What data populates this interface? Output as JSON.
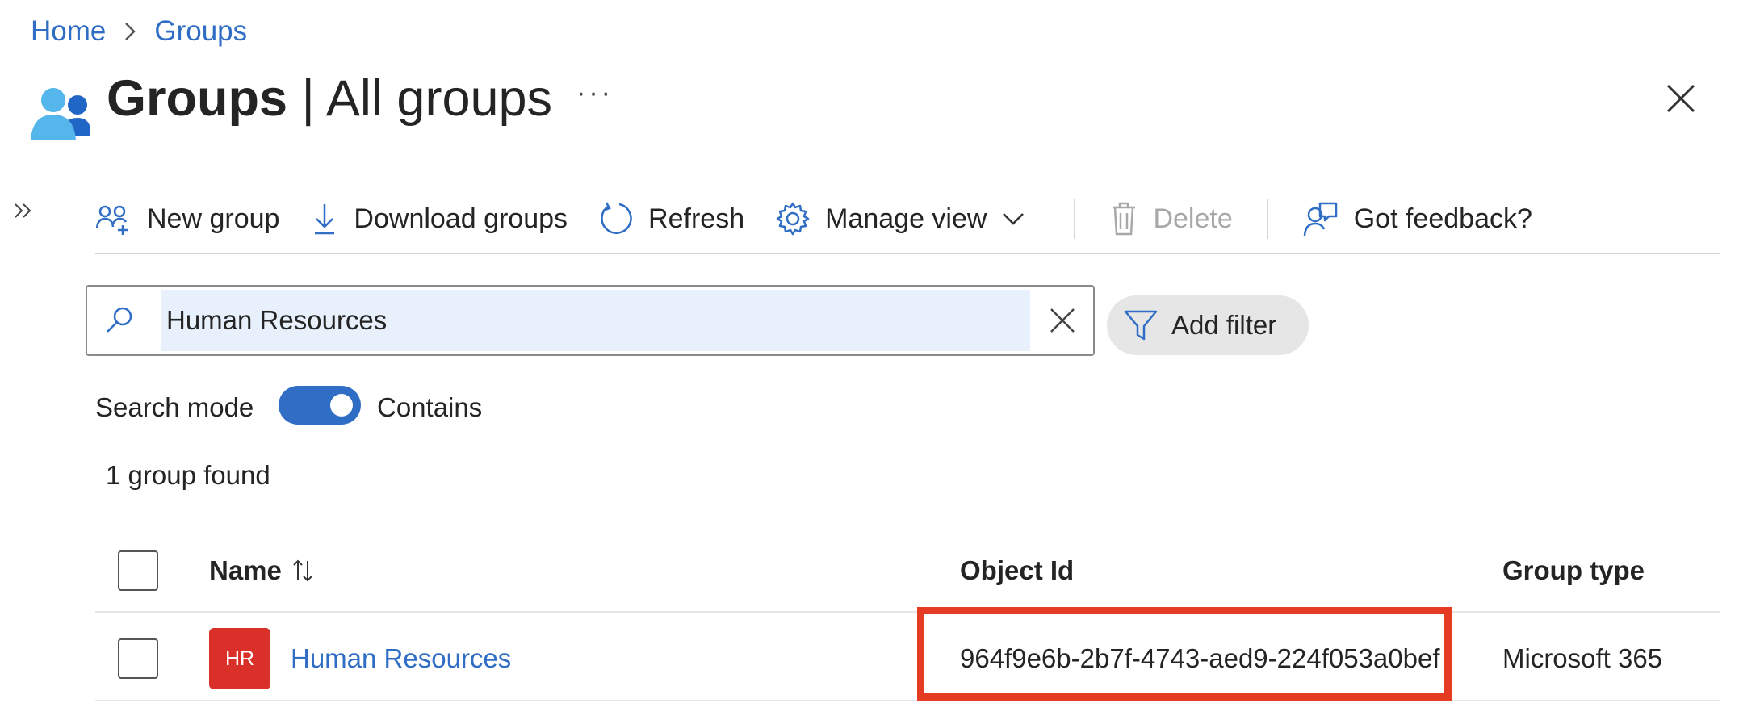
{
  "breadcrumb": {
    "home": "Home",
    "separator": ">",
    "current": "Groups"
  },
  "header": {
    "title_bold": "Groups",
    "title_rest": " | All groups",
    "more": "···",
    "icon": "groups-icon"
  },
  "toolbar": {
    "new_group": "New group",
    "download_groups": "Download groups",
    "refresh": "Refresh",
    "manage_view": "Manage view",
    "delete": "Delete",
    "feedback": "Got feedback?"
  },
  "search": {
    "value": "Human Resources"
  },
  "filter": {
    "add_filter": "Add filter"
  },
  "search_mode": {
    "label": "Search mode",
    "toggle_on": true,
    "value": "Contains"
  },
  "results": {
    "count_text": "1 group found"
  },
  "table": {
    "columns": {
      "name": "Name",
      "object_id": "Object Id",
      "group_type": "Group type"
    },
    "rows": [
      {
        "avatar": "HR",
        "name": "Human Resources",
        "object_id": "964f9e6b-2b7f-4743-aed9-224f053a0bef",
        "group_type": "Microsoft 365"
      }
    ]
  },
  "colors": {
    "accent": "#2f6ec4",
    "avatar_bg": "#d9302a",
    "highlight": "#e43b22",
    "search_bg": "#e8f0fc"
  }
}
